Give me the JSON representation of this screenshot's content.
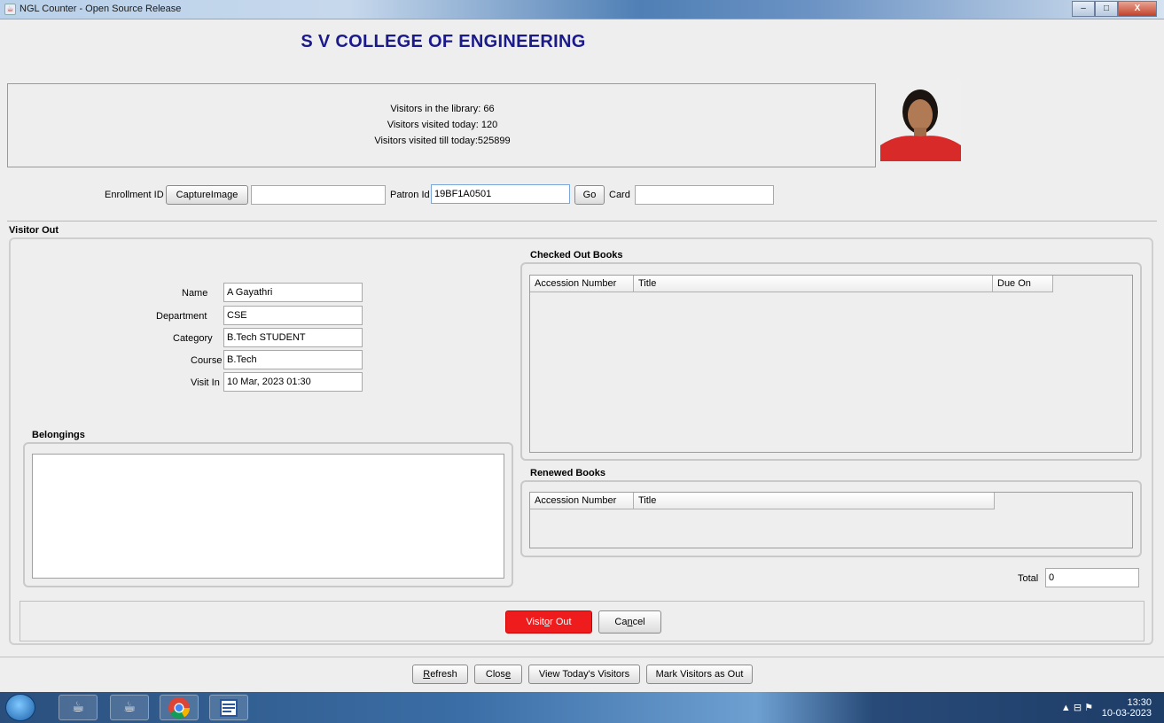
{
  "window": {
    "title": "NGL Counter - Open Source Release",
    "minimize": "–",
    "maximize": "□",
    "close": "X"
  },
  "header": {
    "college": "S V COLLEGE OF ENGINEERING"
  },
  "stats": {
    "in_library_label": "Visitors in the library:",
    "in_library_value": "66",
    "today_label": "Visitors visited today:",
    "today_value": "120",
    "till_today_label": "Visitors visited till today:",
    "till_today_value": "525899"
  },
  "lookup": {
    "enrollment_label": "Enrollment ID",
    "capture_button": "CaptureImage",
    "enrollment_value": "",
    "patron_label": "Patron Id",
    "patron_value": "19BF1A0501",
    "go_button": "Go",
    "card_label": "Card",
    "card_value": ""
  },
  "visitor_out": {
    "title": "Visitor Out",
    "name_label": "Name",
    "name_value": "A Gayathri",
    "department_label": "Department",
    "department_value": "CSE",
    "category_label": "Category",
    "category_value": "B.Tech STUDENT",
    "course_label": "Course",
    "course_value": "B.Tech",
    "visit_in_label": "Visit In",
    "visit_in_value": "10 Mar, 2023 01:30",
    "belongings_title": "Belongings",
    "belongings_value": "",
    "checked_out_title": "Checked Out Books",
    "checked_out_columns": [
      "Accession Number",
      "Title",
      "Due On"
    ],
    "renewed_title": "Renewed Books",
    "renewed_columns": [
      "Accession Number",
      "Title"
    ],
    "total_label": "Total",
    "total_value": "0",
    "visitor_out_button_pre": "Visit",
    "visitor_out_button_u": "o",
    "visitor_out_button_post": "r Out",
    "cancel_button_pre": "Ca",
    "cancel_button_u": "n",
    "cancel_button_post": "cel"
  },
  "footer": {
    "refresh_u": "R",
    "refresh_post": "efresh",
    "close_pre": "Clos",
    "close_u": "e",
    "view_today": "View Today's Visitors",
    "mark_out": "Mark Visitors as Out"
  },
  "taskbar": {
    "time": "13:30",
    "date": "10-03-2023"
  },
  "colors": {
    "accent_red": "#ee1c1c",
    "college_blue": "#1a1a8a"
  }
}
